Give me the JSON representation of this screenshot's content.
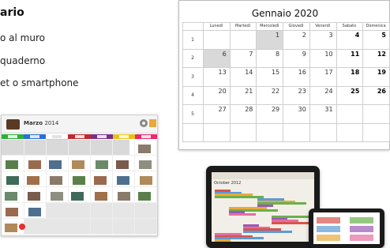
{
  "left_text": {
    "heading": "ario",
    "bullets": [
      "o al muro",
      "quaderno",
      "et o smartphone"
    ]
  },
  "app": {
    "title_month": "Marzo",
    "title_year": "2014",
    "day_tabs": [
      "Lun",
      "Mar",
      "Mer",
      "Gio",
      "Ven",
      "Sab",
      "Dom"
    ]
  },
  "calendar": {
    "title": "Gennaio 2020",
    "days_of_week": [
      "Lunedì",
      "Martedì",
      "Mercoledì",
      "Giovedì",
      "Venerdì",
      "Sabato",
      "Domenica"
    ],
    "weeks": [
      {
        "num": "1",
        "days": [
          "",
          "",
          "1",
          "2",
          "3",
          "4",
          "5"
        ]
      },
      {
        "num": "2",
        "days": [
          "6",
          "7",
          "8",
          "9",
          "10",
          "11",
          "12"
        ]
      },
      {
        "num": "3",
        "days": [
          "13",
          "14",
          "15",
          "16",
          "17",
          "18",
          "19"
        ]
      },
      {
        "num": "4",
        "days": [
          "20",
          "21",
          "22",
          "23",
          "24",
          "25",
          "26"
        ]
      },
      {
        "num": "5",
        "days": [
          "27",
          "28",
          "29",
          "30",
          "31",
          "",
          ""
        ]
      }
    ]
  },
  "tablet": {
    "title": "October 2012"
  },
  "colors": {
    "day_bar": [
      "#2fae3a",
      "#2a6fd6",
      "#ffffff",
      "#c0282d",
      "#7a2f8c",
      "#e8c21a",
      "#e82a6b"
    ]
  }
}
